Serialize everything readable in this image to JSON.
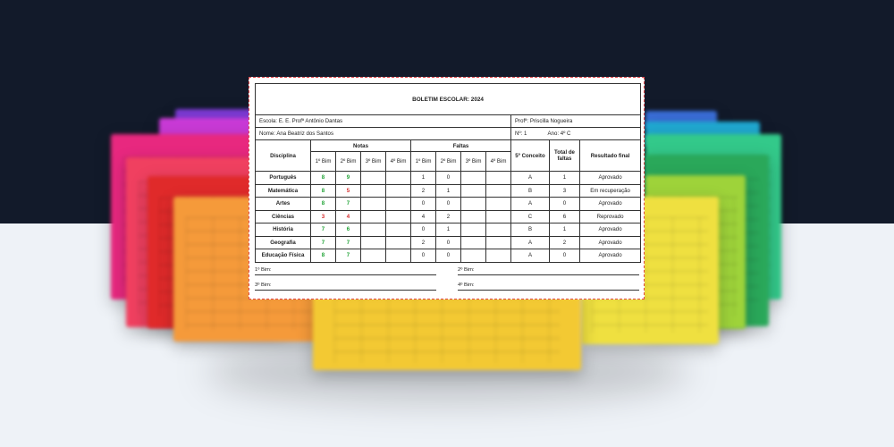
{
  "report": {
    "title": "BOLETIM ESCOLAR: 2024",
    "school_label": "Escola:",
    "school": "E. E. Profª Antônio Dantas",
    "teacher_label": "Profª:",
    "teacher": "Priscilla Nogueira",
    "name_label": "Nome:",
    "student": "Ana Beatriz dos Santos",
    "number_label": "Nº:",
    "number": "1",
    "year_label": "Ano:",
    "year": "4º C",
    "headers": {
      "subject": "Disciplina",
      "grades": "Notas",
      "absences": "Faltas",
      "q1": "1º Bim",
      "q2": "2º Bim",
      "q3": "3º Bim",
      "q4": "4º Bim",
      "concept": "5º Conceito",
      "total_absences": "Total de faltas",
      "final_result": "Resultado final"
    },
    "rows": [
      {
        "subject": "Português",
        "g1": "8",
        "g2": "9",
        "g3": "",
        "g4": "",
        "f1": "1",
        "f2": "0",
        "f3": "",
        "f4": "",
        "concept": "A",
        "total": "1",
        "result": "Aprovado"
      },
      {
        "subject": "Matemática",
        "g1": "8",
        "g2": "5",
        "g3": "",
        "g4": "",
        "f1": "2",
        "f2": "1",
        "f3": "",
        "f4": "",
        "concept": "B",
        "total": "3",
        "result": "Em recuperação"
      },
      {
        "subject": "Artes",
        "g1": "8",
        "g2": "7",
        "g3": "",
        "g4": "",
        "f1": "0",
        "f2": "0",
        "f3": "",
        "f4": "",
        "concept": "A",
        "total": "0",
        "result": "Aprovado"
      },
      {
        "subject": "Ciências",
        "g1": "3",
        "g2": "4",
        "g3": "",
        "g4": "",
        "f1": "4",
        "f2": "2",
        "f3": "",
        "f4": "",
        "concept": "C",
        "total": "6",
        "result": "Reprovado"
      },
      {
        "subject": "História",
        "g1": "7",
        "g2": "6",
        "g3": "",
        "g4": "",
        "f1": "0",
        "f2": "1",
        "f3": "",
        "f4": "",
        "concept": "B",
        "total": "1",
        "result": "Aprovado"
      },
      {
        "subject": "Geografia",
        "g1": "7",
        "g2": "7",
        "g3": "",
        "g4": "",
        "f1": "2",
        "f2": "0",
        "f3": "",
        "f4": "",
        "concept": "A",
        "total": "2",
        "result": "Aprovado"
      },
      {
        "subject": "Educação Física",
        "g1": "8",
        "g2": "7",
        "g3": "",
        "g4": "",
        "f1": "0",
        "f2": "0",
        "f3": "",
        "f4": "",
        "concept": "A",
        "total": "0",
        "result": "Aprovado"
      }
    ],
    "signatures": {
      "b1": "1º Bim:",
      "b2": "2º Bim:",
      "b3": "3º Bim:",
      "b4": "4º Bim:"
    }
  },
  "colors": {
    "pass_grade": "#21a336",
    "fail_grade": "#d62a2a",
    "background_cards": [
      "#7d3bd6",
      "#c93ad6",
      "#e8287f",
      "#f04060",
      "#e02a2a",
      "#f59a3a",
      "#f3c933",
      "#efe040",
      "#9ed33a",
      "#2aa85a",
      "#33c98a",
      "#20a8d0",
      "#3a6ed8"
    ]
  }
}
